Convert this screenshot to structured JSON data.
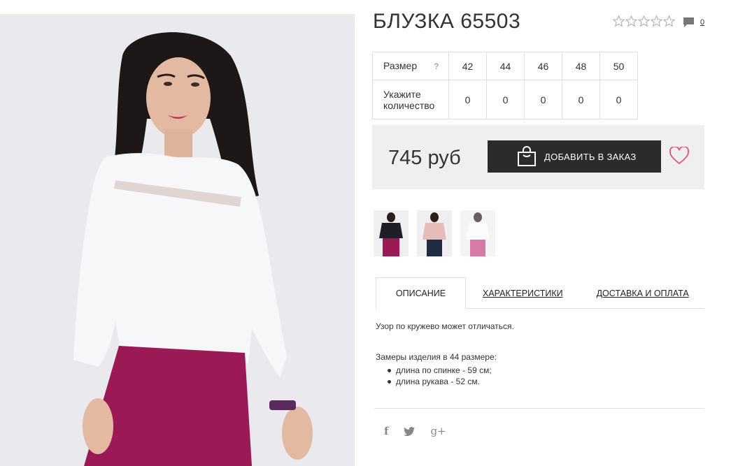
{
  "product": {
    "title": "БЛУЗКА 65503",
    "reviews_count": "0",
    "rating": 0,
    "rating_max": 5
  },
  "sizes": {
    "size_label": "Размер",
    "help_label": "?",
    "qty_label_line1": "Укажите",
    "qty_label_line2": "количество",
    "values": [
      "42",
      "44",
      "46",
      "48",
      "50"
    ],
    "quantities": [
      "0",
      "0",
      "0",
      "0",
      "0"
    ]
  },
  "buy": {
    "price": "745 руб",
    "add_label": "ДОБАВИТЬ В ЗАКАЗ"
  },
  "tabs": {
    "description": "ОПИСАНИЕ",
    "characteristics": "ХАРАКТЕРИСТИКИ",
    "delivery": "ДОСТАВКА И ОПЛАТА"
  },
  "description": {
    "note": "Узор по кружево может отличаться.",
    "measures_title": "Замеры изделия в 44 размере:",
    "measures": [
      "длина по спинке - 59 см;",
      "длина рукава - 52 см."
    ]
  },
  "social": {
    "facebook": "f",
    "twitter": "twitter-icon",
    "gplus": "g+"
  },
  "colors": {
    "accent_dark": "#2b2b2b",
    "heart": "#e0607e",
    "blouse": "#f7f7f9",
    "pants": "#9b1a55",
    "background": "#efefef"
  }
}
